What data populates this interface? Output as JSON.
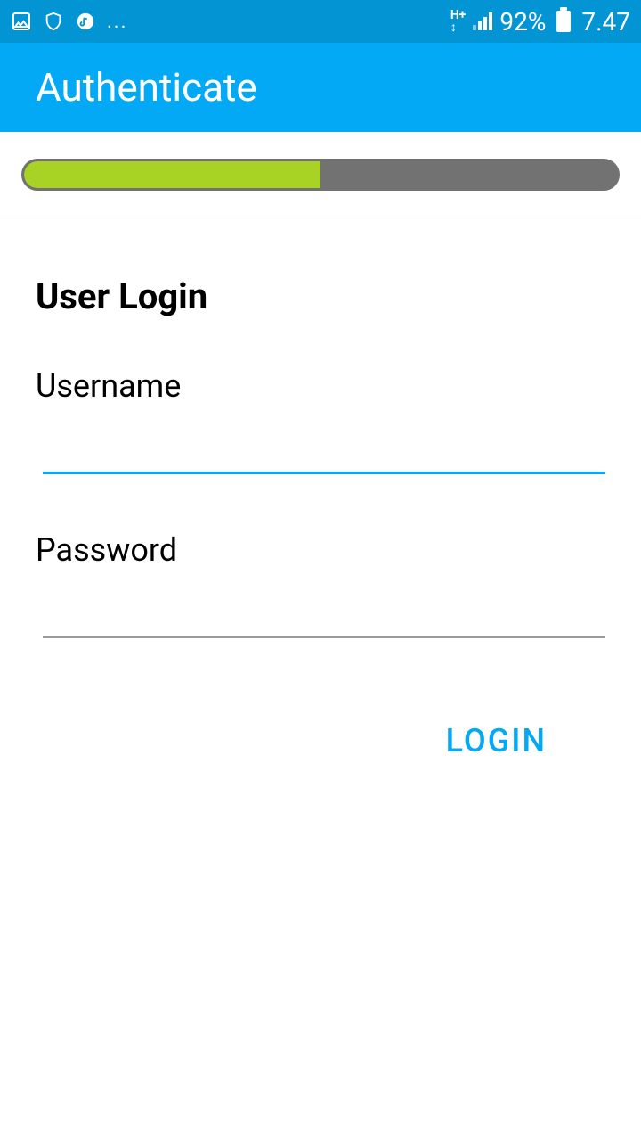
{
  "statusBar": {
    "left": {
      "icons": [
        "image-icon",
        "shield-icon",
        "music-icon"
      ],
      "ellipsis": "..."
    },
    "right": {
      "dataIndicator": "H+",
      "batteryPercent": "92%",
      "time": "7.47"
    }
  },
  "appBar": {
    "title": "Authenticate"
  },
  "progress": {
    "percent": 50
  },
  "login": {
    "heading": "User Login",
    "usernameLabel": "Username",
    "usernameValue": "",
    "passwordLabel": "Password",
    "passwordValue": "",
    "loginButtonLabel": "LOGIN"
  }
}
